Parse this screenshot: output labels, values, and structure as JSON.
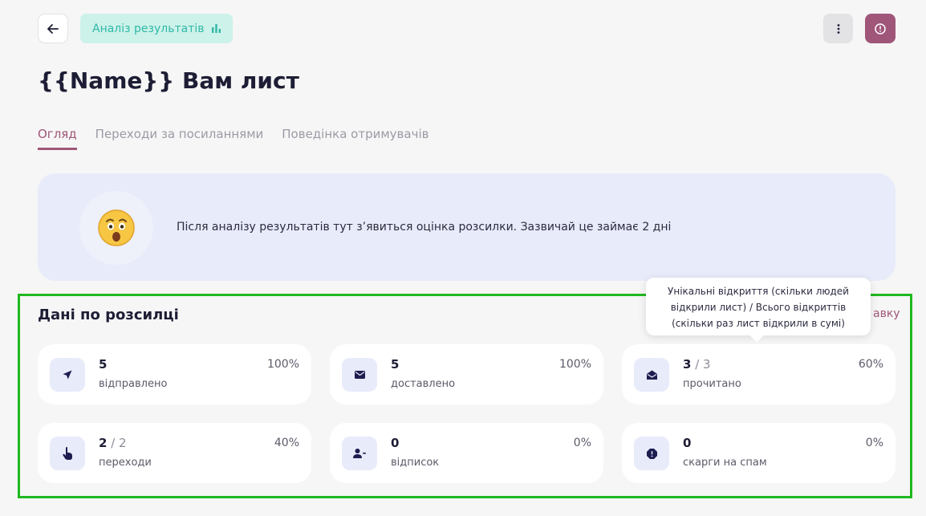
{
  "header": {
    "analysis_chip_label": "Аналіз результатів",
    "page_title": "{{Name}} Вам лист"
  },
  "tabs": [
    {
      "label": "Огляд",
      "active": true
    },
    {
      "label": "Переходи за посиланнями",
      "active": false
    },
    {
      "label": "Поведінка отримувачів",
      "active": false
    }
  ],
  "banner": {
    "emoji": "😲",
    "text": "Після аналізу результатів тут з’явиться оцінка розсилки. Зазвичай це займає 2 дні"
  },
  "stats_section": {
    "title": "Дані по розсилці",
    "link_fragment": "авку",
    "tooltip": "Унікальні відкриття (скільки людей відкрили лист) / Всього відкриттів (скільки раз лист відкрили в сумі)"
  },
  "stats": [
    {
      "icon": "send-icon",
      "value": "5",
      "total": "",
      "label": "відправлено",
      "percent": "100%"
    },
    {
      "icon": "envelope-icon",
      "value": "5",
      "total": "",
      "label": "доставлено",
      "percent": "100%"
    },
    {
      "icon": "envelope-open-icon",
      "value": "3",
      "total": "3",
      "label": "прочитано",
      "percent": "60%"
    },
    {
      "icon": "pointer-hand-icon",
      "value": "2",
      "total": "2",
      "label": "переходи",
      "percent": "40%"
    },
    {
      "icon": "user-minus-icon",
      "value": "0",
      "total": "",
      "label": "відписок",
      "percent": "0%"
    },
    {
      "icon": "alert-octagon-icon",
      "value": "0",
      "total": "",
      "label": "скарги на спам",
      "percent": "0%"
    }
  ],
  "colors": {
    "accent": "#a05679",
    "teal_chip_bg": "#cdf2ea",
    "teal_chip_text": "#2fb9a7",
    "banner_bg": "#e8ebfa",
    "highlight": "#1fb81f",
    "icon_color": "#1d1d50"
  }
}
